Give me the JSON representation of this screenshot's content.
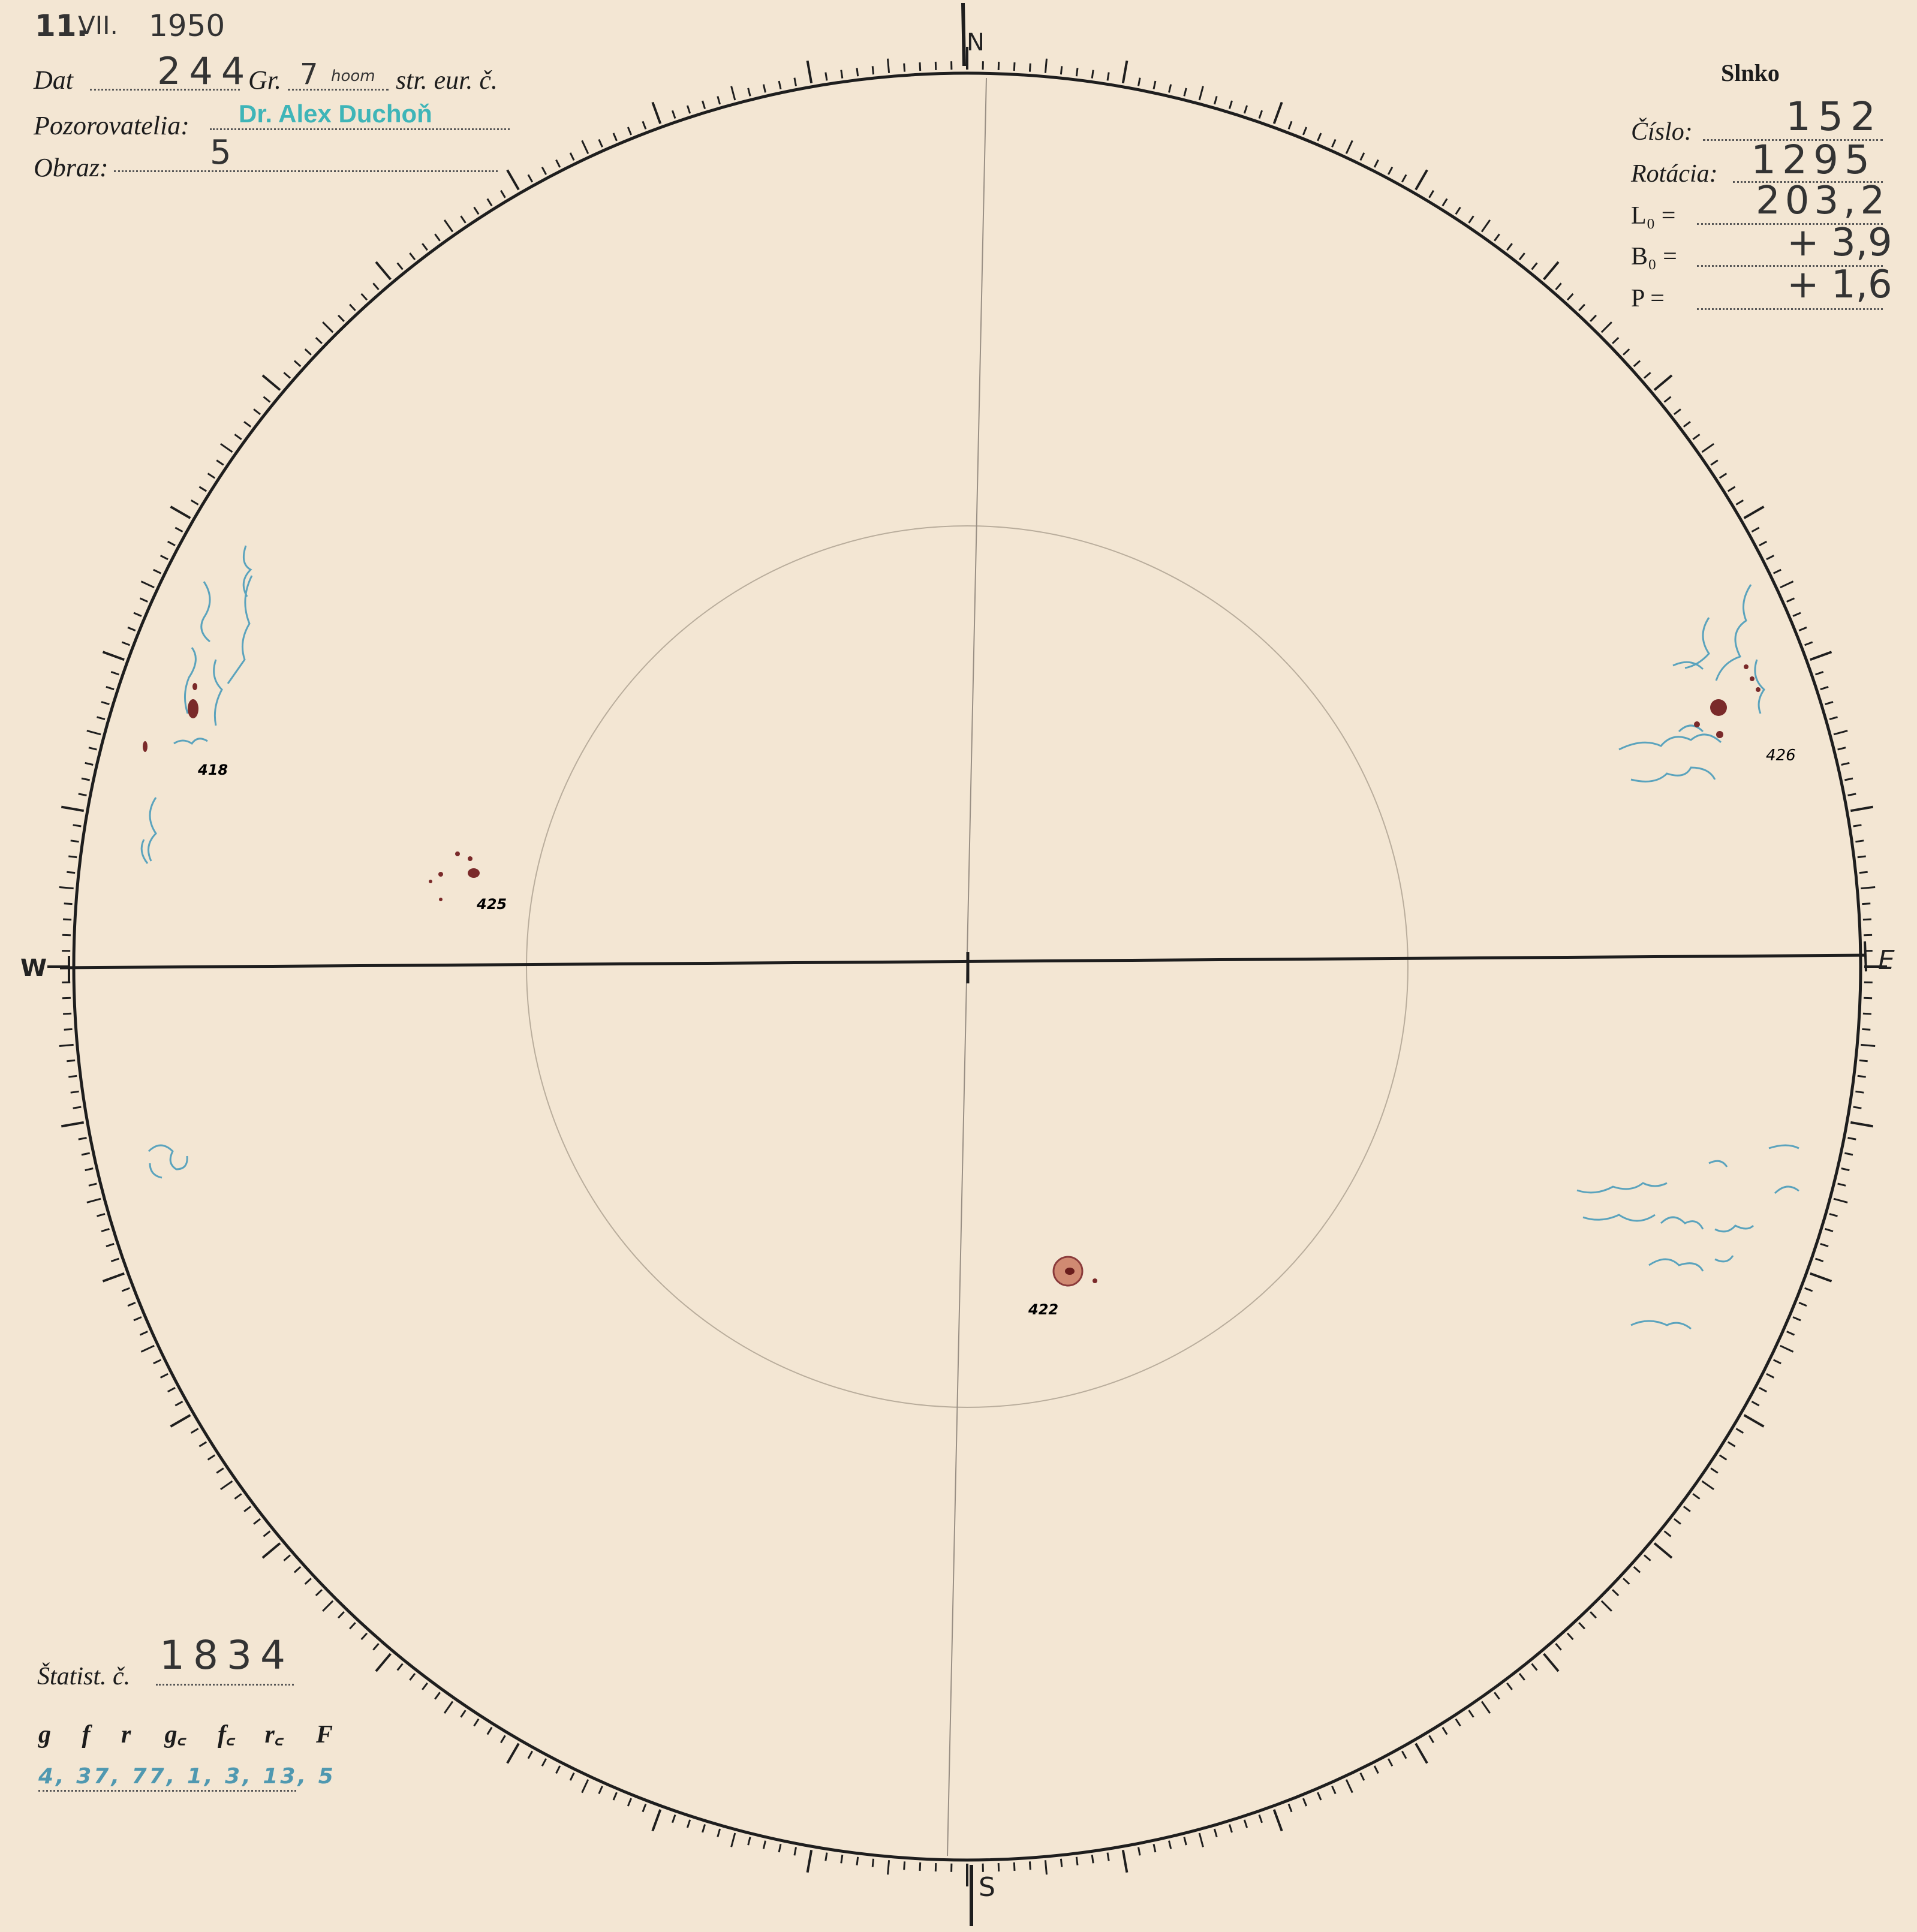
{
  "header": {
    "date_day": "11.",
    "date_month": "VII.",
    "date_year": "1950",
    "dat_label": "Dat",
    "dat_value": "244",
    "gr_label": "Gr.",
    "gr_hour": "7",
    "gr_minutes": "hoom",
    "gr_suffix": "str. eur. č.",
    "observers_label": "Pozorovatelia:",
    "observers_value": "Dr. Alex Duchoň",
    "image_label": "Obraz:",
    "image_value": "5"
  },
  "sun_card": {
    "title": "Slnko",
    "cislo_label": "Číslo:",
    "cislo_value": "152",
    "rotacia_label": "Rotácia:",
    "rotacia_value": "1295",
    "l0_label": "L₀ =",
    "l0_value": "203,2",
    "b0_label": "B₀ =",
    "b0_value": "+ 3,9",
    "p_label": "P =",
    "p_value": "+ 1,6"
  },
  "compass": {
    "north": "N",
    "south": "S",
    "east": "E",
    "west": "W"
  },
  "sunspot_groups": [
    {
      "id": "418",
      "color": "#d8306a"
    },
    {
      "id": "425",
      "color": "#d8306a"
    },
    {
      "id": "426",
      "color": "#c05050"
    },
    {
      "id": "422",
      "color": "#d8306a"
    }
  ],
  "statistics": {
    "label": "Štatist. č.",
    "value": "1834",
    "columns": [
      "g",
      "f",
      "r",
      "g꜀",
      "f꜀",
      "r꜀",
      "F"
    ],
    "values_line": "4, 37, 77, 1, 3, 13, 5"
  },
  "colors": {
    "paper": "#f3e6d3",
    "ink": "#1c1c1c",
    "spot": "#d8306a",
    "facula": "#4f98b0"
  }
}
